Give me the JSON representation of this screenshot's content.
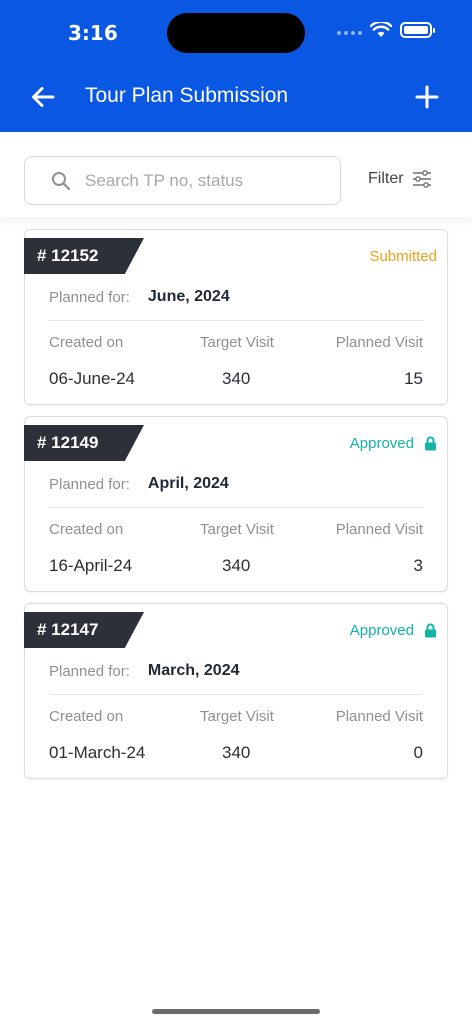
{
  "status_bar": {
    "time": "3:16"
  },
  "header": {
    "title": "Tour Plan Submission"
  },
  "search": {
    "placeholder": "Search TP no, status"
  },
  "filter": {
    "label": "Filter"
  },
  "columns": {
    "created": "Created on",
    "target": "Target Visit",
    "planned": "Planned Visit"
  },
  "planned_for_label": "Planned for:",
  "colors": {
    "brand": "#0a57e3",
    "submitted": "#e8a317",
    "approved": "#13b3a6"
  },
  "plans": [
    {
      "tp": "# 12152",
      "status": "Submitted",
      "status_color": "#e8a317",
      "locked": false,
      "planned_for": "June, 2024",
      "created_on": "06-June-24",
      "target_visit": "340",
      "planned_visit": "15"
    },
    {
      "tp": "# 12149",
      "status": "Approved",
      "status_color": "#13b3a6",
      "locked": true,
      "planned_for": "April, 2024",
      "created_on": "16-April-24",
      "target_visit": "340",
      "planned_visit": "3"
    },
    {
      "tp": "# 12147",
      "status": "Approved",
      "status_color": "#13b3a6",
      "locked": true,
      "planned_for": "March, 2024",
      "created_on": "01-March-24",
      "target_visit": "340",
      "planned_visit": "0"
    }
  ]
}
